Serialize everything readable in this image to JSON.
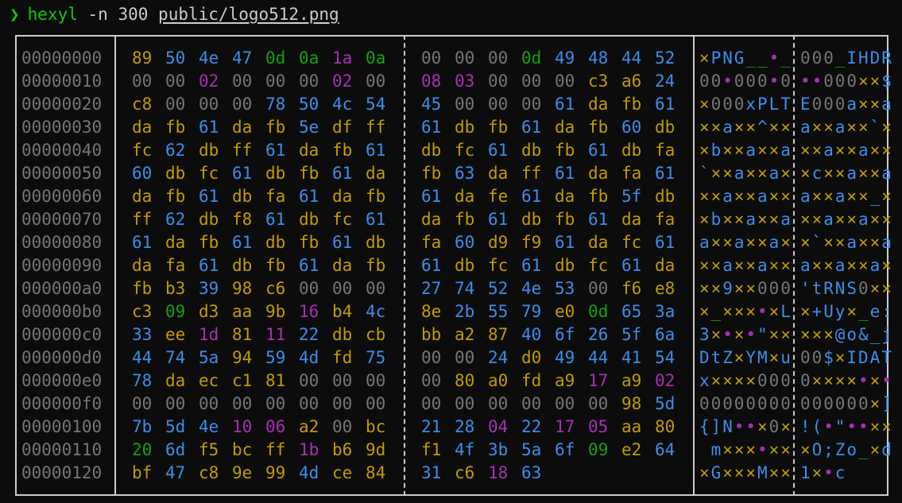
{
  "prompt": {
    "symbol": "❯",
    "command": "hexyl",
    "args": "-n 300",
    "path": "public/logo512.png"
  },
  "colors": {
    "null": "#767676",
    "ascii_other": "#c19c00",
    "ascii_printable": "#3b8eea",
    "whitespace": "#13a10e",
    "control": "#a72fb5"
  },
  "rows": [
    {
      "offset": "00000000",
      "hex": [
        "89",
        "50",
        "4e",
        "47",
        "0d",
        "0a",
        "1a",
        "0a",
        "00",
        "00",
        "00",
        "0d",
        "49",
        "48",
        "44",
        "52"
      ],
      "ascii": [
        "×",
        "P",
        "N",
        "G",
        "_",
        "_",
        "•",
        "_",
        "0",
        "0",
        "0",
        "_",
        "I",
        "H",
        "D",
        "R"
      ]
    },
    {
      "offset": "00000010",
      "hex": [
        "00",
        "00",
        "02",
        "00",
        "00",
        "00",
        "02",
        "00",
        "08",
        "03",
        "00",
        "00",
        "00",
        "c3",
        "a6",
        "24"
      ],
      "ascii": [
        "0",
        "0",
        "•",
        "0",
        "0",
        "0",
        "•",
        "0",
        "•",
        "•",
        "0",
        "0",
        "0",
        "×",
        "×",
        "$"
      ]
    },
    {
      "offset": "00000020",
      "hex": [
        "c8",
        "00",
        "00",
        "00",
        "78",
        "50",
        "4c",
        "54",
        "45",
        "00",
        "00",
        "00",
        "61",
        "da",
        "fb",
        "61"
      ],
      "ascii": [
        "×",
        "0",
        "0",
        "0",
        "x",
        "P",
        "L",
        "T",
        "E",
        "0",
        "0",
        "0",
        "a",
        "×",
        "×",
        "a"
      ]
    },
    {
      "offset": "00000030",
      "hex": [
        "da",
        "fb",
        "61",
        "da",
        "fb",
        "5e",
        "df",
        "ff",
        "61",
        "db",
        "fb",
        "61",
        "da",
        "fb",
        "60",
        "db"
      ],
      "ascii": [
        "×",
        "×",
        "a",
        "×",
        "×",
        "^",
        "×",
        "×",
        "a",
        "×",
        "×",
        "a",
        "×",
        "×",
        "`",
        "×"
      ]
    },
    {
      "offset": "00000040",
      "hex": [
        "fc",
        "62",
        "db",
        "ff",
        "61",
        "da",
        "fb",
        "61",
        "db",
        "fc",
        "61",
        "db",
        "fb",
        "61",
        "db",
        "fa"
      ],
      "ascii": [
        "×",
        "b",
        "×",
        "×",
        "a",
        "×",
        "×",
        "a",
        "×",
        "×",
        "a",
        "×",
        "×",
        "a",
        "×",
        "×"
      ]
    },
    {
      "offset": "00000050",
      "hex": [
        "60",
        "db",
        "fc",
        "61",
        "db",
        "fb",
        "61",
        "da",
        "fb",
        "63",
        "da",
        "ff",
        "61",
        "da",
        "fa",
        "61"
      ],
      "ascii": [
        "`",
        "×",
        "×",
        "a",
        "×",
        "×",
        "a",
        "×",
        "×",
        "c",
        "×",
        "×",
        "a",
        "×",
        "×",
        "a"
      ]
    },
    {
      "offset": "00000060",
      "hex": [
        "da",
        "fb",
        "61",
        "db",
        "fa",
        "61",
        "da",
        "fb",
        "61",
        "da",
        "fe",
        "61",
        "da",
        "fb",
        "5f",
        "db"
      ],
      "ascii": [
        "×",
        "×",
        "a",
        "×",
        "×",
        "a",
        "×",
        "×",
        "a",
        "×",
        "×",
        "a",
        "×",
        "×",
        "_",
        "×"
      ]
    },
    {
      "offset": "00000070",
      "hex": [
        "ff",
        "62",
        "db",
        "f8",
        "61",
        "db",
        "fc",
        "61",
        "da",
        "fb",
        "61",
        "db",
        "fb",
        "61",
        "da",
        "fa"
      ],
      "ascii": [
        "×",
        "b",
        "×",
        "×",
        "a",
        "×",
        "×",
        "a",
        "×",
        "×",
        "a",
        "×",
        "×",
        "a",
        "×",
        "×"
      ]
    },
    {
      "offset": "00000080",
      "hex": [
        "61",
        "da",
        "fb",
        "61",
        "db",
        "fb",
        "61",
        "db",
        "fa",
        "60",
        "d9",
        "f9",
        "61",
        "da",
        "fc",
        "61"
      ],
      "ascii": [
        "a",
        "×",
        "×",
        "a",
        "×",
        "×",
        "a",
        "×",
        "×",
        "`",
        "×",
        "×",
        "a",
        "×",
        "×",
        "a"
      ]
    },
    {
      "offset": "00000090",
      "hex": [
        "da",
        "fa",
        "61",
        "db",
        "fb",
        "61",
        "da",
        "fb",
        "61",
        "db",
        "fc",
        "61",
        "db",
        "fc",
        "61",
        "da"
      ],
      "ascii": [
        "×",
        "×",
        "a",
        "×",
        "×",
        "a",
        "×",
        "×",
        "a",
        "×",
        "×",
        "a",
        "×",
        "×",
        "a",
        "×"
      ]
    },
    {
      "offset": "000000a0",
      "hex": [
        "fb",
        "b3",
        "39",
        "98",
        "c6",
        "00",
        "00",
        "00",
        "27",
        "74",
        "52",
        "4e",
        "53",
        "00",
        "f6",
        "e8"
      ],
      "ascii": [
        "×",
        "×",
        "9",
        "×",
        "×",
        "0",
        "0",
        "0",
        "'",
        "t",
        "R",
        "N",
        "S",
        "0",
        "×",
        "×"
      ]
    },
    {
      "offset": "000000b0",
      "hex": [
        "c3",
        "09",
        "d3",
        "aa",
        "9b",
        "16",
        "b4",
        "4c",
        "8e",
        "2b",
        "55",
        "79",
        "e0",
        "0d",
        "65",
        "3a"
      ],
      "ascii": [
        "×",
        "_",
        "×",
        "×",
        "×",
        "•",
        "×",
        "L",
        "×",
        "+",
        "U",
        "y",
        "×",
        "_",
        "e",
        ":"
      ]
    },
    {
      "offset": "000000c0",
      "hex": [
        "33",
        "ee",
        "1d",
        "81",
        "11",
        "22",
        "db",
        "cb",
        "bb",
        "a2",
        "87",
        "40",
        "6f",
        "26",
        "5f",
        "6a"
      ],
      "ascii": [
        "3",
        "×",
        "•",
        "×",
        "•",
        "\"",
        "×",
        "×",
        "×",
        "×",
        "×",
        "@",
        "o",
        "&",
        "_",
        "j"
      ]
    },
    {
      "offset": "000000d0",
      "hex": [
        "44",
        "74",
        "5a",
        "94",
        "59",
        "4d",
        "fd",
        "75",
        "00",
        "00",
        "24",
        "d0",
        "49",
        "44",
        "41",
        "54"
      ],
      "ascii": [
        "D",
        "t",
        "Z",
        "×",
        "Y",
        "M",
        "×",
        "u",
        "0",
        "0",
        "$",
        "×",
        "I",
        "D",
        "A",
        "T"
      ]
    },
    {
      "offset": "000000e0",
      "hex": [
        "78",
        "da",
        "ec",
        "c1",
        "81",
        "00",
        "00",
        "00",
        "00",
        "80",
        "a0",
        "fd",
        "a9",
        "17",
        "a9",
        "02"
      ],
      "ascii": [
        "x",
        "×",
        "×",
        "×",
        "×",
        "0",
        "0",
        "0",
        "0",
        "×",
        "×",
        "×",
        "×",
        "•",
        "×",
        "•"
      ]
    },
    {
      "offset": "000000f0",
      "hex": [
        "00",
        "00",
        "00",
        "00",
        "00",
        "00",
        "00",
        "00",
        "00",
        "00",
        "00",
        "00",
        "00",
        "00",
        "98",
        "5d"
      ],
      "ascii": [
        "0",
        "0",
        "0",
        "0",
        "0",
        "0",
        "0",
        "0",
        "0",
        "0",
        "0",
        "0",
        "0",
        "0",
        "×",
        "]"
      ]
    },
    {
      "offset": "00000100",
      "hex": [
        "7b",
        "5d",
        "4e",
        "10",
        "06",
        "a2",
        "00",
        "bc",
        "21",
        "28",
        "04",
        "22",
        "17",
        "05",
        "aa",
        "80"
      ],
      "ascii": [
        "{",
        "]",
        "N",
        "•",
        "•",
        "×",
        "0",
        "×",
        "!",
        "(",
        "•",
        "\"",
        "•",
        "•",
        "×",
        "×"
      ]
    },
    {
      "offset": "00000110",
      "hex": [
        "20",
        "6d",
        "f5",
        "bc",
        "ff",
        "1b",
        "b6",
        "9d",
        "f1",
        "4f",
        "3b",
        "5a",
        "6f",
        "09",
        "e2",
        "64"
      ],
      "ascii": [
        " ",
        "m",
        "×",
        "×",
        "×",
        "•",
        "×",
        "×",
        "×",
        "O",
        ";",
        "Z",
        "o",
        "_",
        "×",
        "d"
      ]
    },
    {
      "offset": "00000120",
      "hex": [
        "bf",
        "47",
        "c8",
        "9e",
        "99",
        "4d",
        "ce",
        "84",
        "31",
        "c6",
        "18",
        "63"
      ],
      "ascii": [
        "×",
        "G",
        "×",
        "×",
        "×",
        "M",
        "×",
        "×",
        "1",
        "×",
        "•",
        "c"
      ]
    }
  ]
}
